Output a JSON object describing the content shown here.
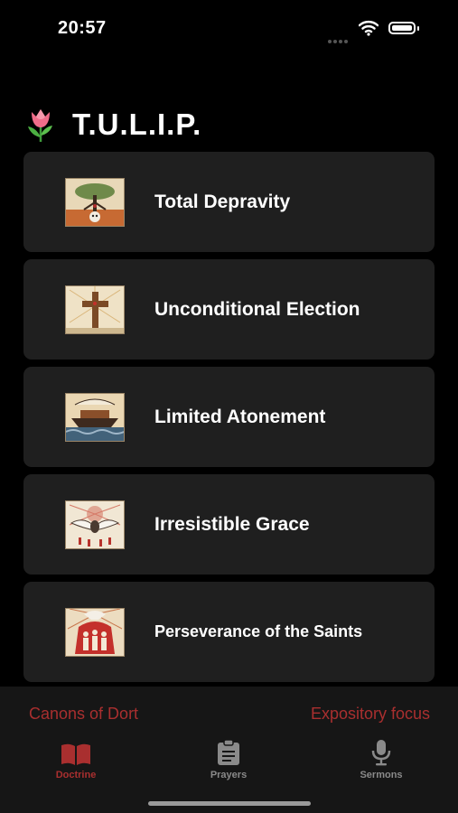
{
  "status_bar": {
    "time": "20:57"
  },
  "header": {
    "icon": "tulip-icon",
    "title": "T.U.L.I.P."
  },
  "doctrines": [
    {
      "label": "Total Depravity",
      "icon": "tree-skull-icon"
    },
    {
      "label": "Unconditional Election",
      "icon": "cross-icon"
    },
    {
      "label": "Limited Atonement",
      "icon": "ark-icon"
    },
    {
      "label": "Irresistible Grace",
      "icon": "dove-icon"
    },
    {
      "label": "Perseverance of the Saints",
      "icon": "saints-icon"
    }
  ],
  "footer": {
    "left_text": "Canons of Dort",
    "right_text": "Expository focus"
  },
  "tabs": [
    {
      "label": "Doctrine",
      "icon": "book-icon",
      "active": true
    },
    {
      "label": "Prayers",
      "icon": "clipboard-icon",
      "active": false
    },
    {
      "label": "Sermons",
      "icon": "microphone-icon",
      "active": false
    }
  ],
  "colors": {
    "accent": "#a92f2f",
    "card_bg": "#1f1f1f",
    "background": "#000000",
    "tab_bar_bg": "#161616"
  }
}
